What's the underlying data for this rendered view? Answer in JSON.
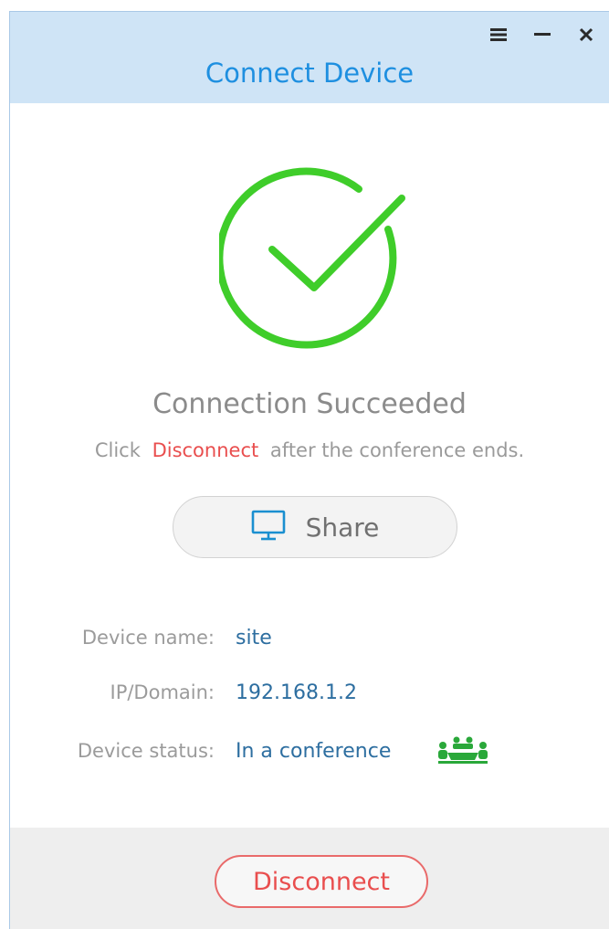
{
  "window": {
    "title": "Connect Device",
    "controls": {
      "menu_icon": "menu-icon",
      "minimize_icon": "minimize-icon",
      "close_icon": "close-icon"
    }
  },
  "status": {
    "icon": "checkmark-circle-icon",
    "title": "Connection Succeeded",
    "hint_prefix": "Click",
    "hint_link": "Disconnect",
    "hint_suffix": "after the conference ends."
  },
  "share_button": {
    "icon": "monitor-icon",
    "label": "Share"
  },
  "device_info": {
    "name_label": "Device name:",
    "name_value": "site",
    "ip_label": "IP/Domain:",
    "ip_value": "192.168.1.2",
    "status_label": "Device status:",
    "status_value": "In a conference",
    "status_icon": "conference-icon"
  },
  "footer": {
    "disconnect_label": "Disconnect"
  },
  "colors": {
    "title_blue": "#1e8fe0",
    "titlebar_bg": "#cfe4f6",
    "success_green": "#3fcd2a",
    "alert_red": "#e94e4e",
    "value_blue": "#2d6ea0",
    "conference_green": "#2aa83a"
  }
}
